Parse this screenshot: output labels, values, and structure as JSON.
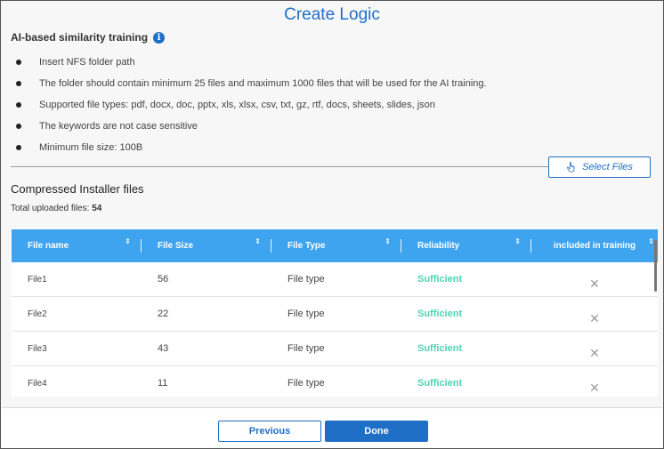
{
  "dialog": {
    "title": "Create Logic",
    "section_title": "AI-based similarity training",
    "info_icon": "i",
    "bullets": [
      "Insert NFS folder path",
      "The folder should contain minimum 25 files and maximum 1000 files that will be used for the AI training.",
      "Supported file types: pdf, docx, doc, pptx, xls, xlsx, csv, txt, gz, rtf, docs, sheets, slides, json",
      "The keywords are not case sensitive",
      "Minimum file size: 100B"
    ],
    "select_files_label": "Select Files",
    "select_files_icon": "hand-pointer-icon",
    "subtitle": "Compressed Installer files",
    "total_label": "Total uploaded files:",
    "total_value": "54"
  },
  "table": {
    "columns": [
      "File name",
      "File Size",
      "File Type",
      "Reliability",
      "included in training"
    ],
    "sort_glyph": "⇕",
    "rows": [
      {
        "name": "File1",
        "size": "56",
        "type": "File type",
        "reliability": "Sufficient",
        "included": "✕"
      },
      {
        "name": "File2",
        "size": "22",
        "type": "File type",
        "reliability": "Sufficient",
        "included": "✕"
      },
      {
        "name": "File3",
        "size": "43",
        "type": "File type",
        "reliability": "Sufficient",
        "included": "✕"
      },
      {
        "name": "File4",
        "size": "11",
        "type": "File type",
        "reliability": "Sufficient",
        "included": "✕"
      }
    ]
  },
  "footer": {
    "previous_label": "Previous",
    "done_label": "Done"
  },
  "colors": {
    "accent": "#1f6fc6",
    "header_bg": "#3fa4f0",
    "sufficient": "#4fd3b4"
  }
}
